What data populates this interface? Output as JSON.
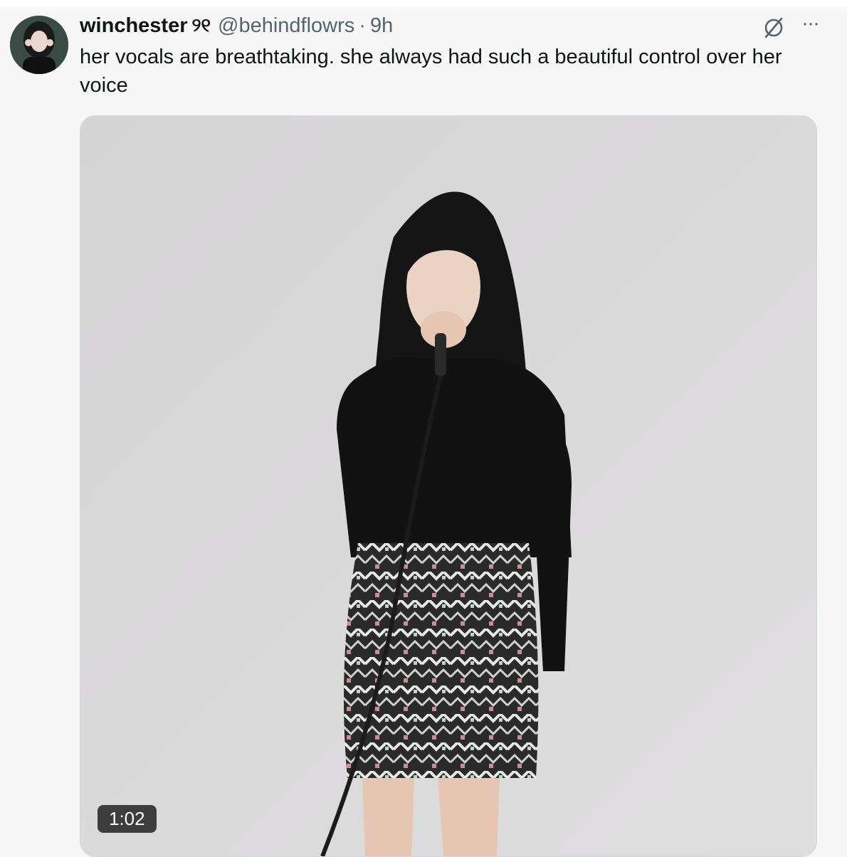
{
  "tweet": {
    "author_name": "winchester",
    "author_name_deco": "୨୧",
    "handle": "@behindflowrs",
    "separator": "·",
    "time": "9h",
    "text": "her vocals are breathtaking. she always had such a beautiful control over her voice",
    "media": {
      "type": "video",
      "duration": "1:02"
    }
  },
  "icons": {
    "grok": "grok-slash-icon",
    "more": "more-icon",
    "more_glyph": "···"
  },
  "colors": {
    "text_primary": "#0f1419",
    "text_secondary": "#536471",
    "background": "#f7f7f7"
  }
}
